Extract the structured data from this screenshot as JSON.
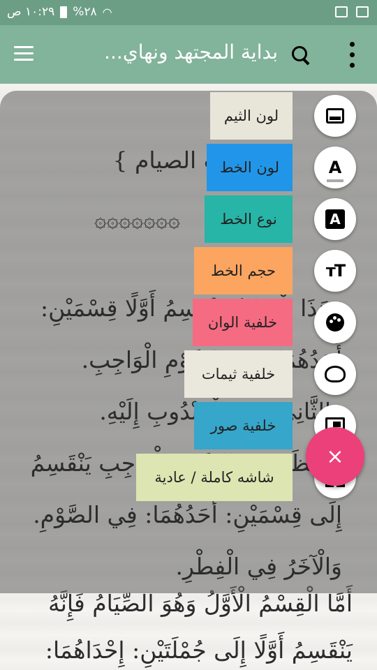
{
  "status_bar": {
    "time": "١٠:٢٩ ص",
    "battery": "%٢٨"
  },
  "toolbar": {
    "title": "بداية المجتهد ونهاي..."
  },
  "book": {
    "heading": "{ كتاب الصيام }",
    "stars": "۞۞۞۞۞۞۞",
    "lines": [
      "وَهَذَا الْكِتَابُ يَنْقَسِمُ أَوَّلًا قِسْمَيْنِ:",
      "أَحَدُهُمَا: فِي الصَّوْمِ الْوَاجِبِ.",
      "وَالثَّانِي: فِي الْمَنْدُوبِ إِلَيْهِ.",
      "وَالنَّظَرُ فِي الصَّوْمِ الْوَاجِبِ يَنْقَسِمُ",
      "إِلَى قِسْمَيْنِ: أَحَدُهُمَا: فِي الصَّوْمِ.",
      "وَالْآخَرُ فِي الْفِطْرِ."
    ],
    "visible_lines": [
      "أَمَّا الْقِسْمُ الْأَوَّلُ وَهُوَ الصِّيَامُ فَإِنَّهُ",
      "يَنْقَسِمُ أَوَّلًا إِلَى جُمْلَتَيْنِ: إِحْدَاهُمَا:"
    ]
  },
  "menu": [
    {
      "label": "لون الثيم",
      "icon": "screen-icon",
      "color": "#e8e6d9"
    },
    {
      "label": "لون الخط",
      "icon": "text-color-icon",
      "color": "#2196e9"
    },
    {
      "label": "نوع الخط",
      "icon": "font-type-icon",
      "color": "#26b5a6"
    },
    {
      "label": "حجم الخط",
      "icon": "font-size-icon",
      "color": "#fba560"
    },
    {
      "label": "خلفية الوان",
      "icon": "palette-icon",
      "color": "#f56b82"
    },
    {
      "label": "خلفية ثيمات",
      "icon": "gamepad-icon",
      "color": "#eae8dd"
    },
    {
      "label": "خلفية صور",
      "icon": "picture-icon",
      "color": "#36a6ca"
    },
    {
      "label": "شاشه كاملة / عادية",
      "icon": "fullscreen-icon",
      "color": "#dde6b2"
    }
  ],
  "close_label": "×"
}
